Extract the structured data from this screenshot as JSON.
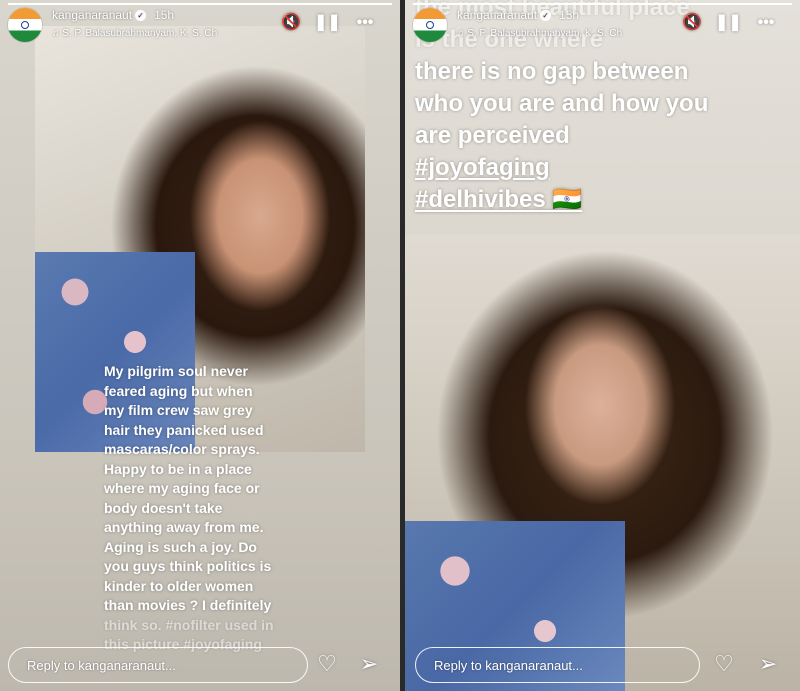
{
  "stories": {
    "left": {
      "username": "kanganaranaut",
      "time": "15h",
      "music": "♫ S. P. Balasubrahmanyam, K. S. Ch",
      "caption_lines": [
        "My pilgrim soul never",
        "feared aging but when",
        "my film crew saw grey",
        "hair they panicked used",
        "mascaras/color sprays.",
        "Happy to be in a place",
        "where my aging face or",
        "body doesn't take",
        "anything away from me.",
        "Aging is such a joy. Do",
        "you guys think politics is",
        "kinder to older women",
        "than movies ? I definitely",
        "think so. #nofilter used in",
        "this picture #joyofaging"
      ],
      "reply_placeholder": "Reply to kanganaranaut..."
    },
    "right": {
      "username": "kanganaranaut",
      "time": "15h",
      "music": "♫ S. P. Balasubrahmanyam, K. S. Ch",
      "caption_lines": [
        "the most beautiful place",
        "is the one where",
        "there is no gap between",
        "who you are and how you",
        "are perceived",
        "#joyofaging",
        "#delhivibes 🇮🇳"
      ],
      "reply_placeholder": "Reply to kanganaranaut..."
    }
  },
  "icons": {
    "mute": "speaker-muted-icon",
    "pause": "pause-icon",
    "more": "more-icon",
    "like": "heart-icon",
    "share": "send-icon"
  },
  "colors": {
    "flag_saffron": "#f29a33",
    "flag_green": "#1f8a3b"
  }
}
